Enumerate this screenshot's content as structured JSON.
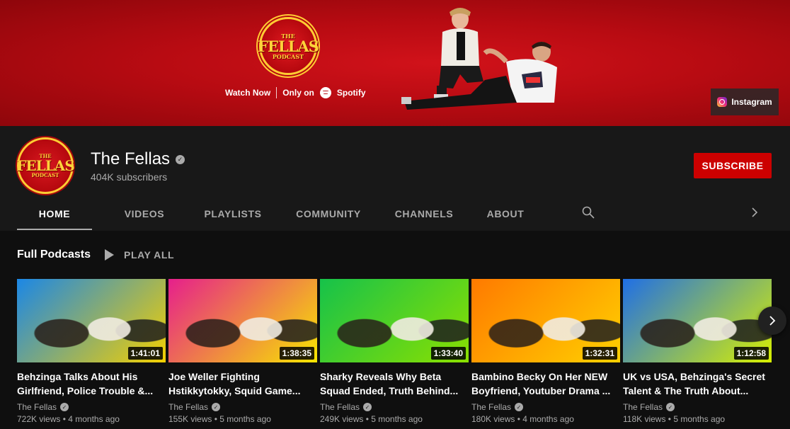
{
  "banner": {
    "logo_small": "THE",
    "logo_big": "FELLAS",
    "logo_sub": "PODCAST",
    "watch_now": "Watch Now",
    "only_on": "Only on",
    "spotify": "Spotify",
    "instagram_label": "Instagram"
  },
  "channel": {
    "name": "The Fellas",
    "subscribers": "404K subscribers",
    "subscribe_label": "SUBSCRIBE",
    "verified_glyph": "✓"
  },
  "tabs": [
    {
      "label": "HOME",
      "active": true
    },
    {
      "label": "VIDEOS"
    },
    {
      "label": "PLAYLISTS"
    },
    {
      "label": "COMMUNITY"
    },
    {
      "label": "CHANNELS"
    },
    {
      "label": "ABOUT"
    }
  ],
  "shelf": {
    "title": "Full Podcasts",
    "play_all": "PLAY ALL"
  },
  "videos": [
    {
      "title": "Behzinga Talks About His Girlfriend, Police Trouble &...",
      "duration": "1:41:01",
      "channel": "The Fellas",
      "meta": "722K views • 4 months ago",
      "colors": [
        "#1b87e6",
        "#f4d000"
      ]
    },
    {
      "title": "Joe Weller Fighting Hstikkytokky, Squid Game...",
      "duration": "1:38:35",
      "channel": "The Fellas",
      "meta": "155K views • 5 months ago",
      "colors": [
        "#e61f8c",
        "#f7e600"
      ]
    },
    {
      "title": "Sharky Reveals Why Beta Squad Ended, Truth Behind...",
      "duration": "1:33:40",
      "channel": "The Fellas",
      "meta": "249K views • 5 months ago",
      "colors": [
        "#16c24a",
        "#8be000"
      ]
    },
    {
      "title": "Bambino Becky On Her NEW Boyfriend, Youtuber Drama ...",
      "duration": "1:32:31",
      "channel": "The Fellas",
      "meta": "180K views • 4 months ago",
      "colors": [
        "#ff7a00",
        "#ffd000"
      ]
    },
    {
      "title": "UK vs USA, Behzinga's Secret Talent & The Truth About...",
      "duration": "1:12:58",
      "channel": "The Fellas",
      "meta": "118K views • 5 months ago",
      "colors": [
        "#1f6fe6",
        "#d8f000"
      ]
    }
  ]
}
